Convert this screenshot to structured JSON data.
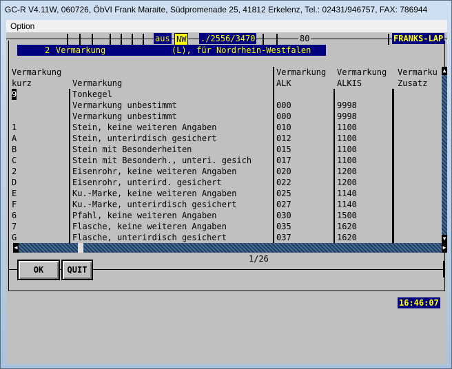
{
  "window": {
    "title": "GC-R V4.11W,   060726, ÖbVI Frank Maraite, Südpromenade 25, 41812 Erkelenz, Tel.: 02431/946757, FAX: 786944"
  },
  "menu": {
    "items": [
      "Option"
    ]
  },
  "toolbar": {
    "source_label": "aus",
    "region": "NW",
    "record_path": "./2556/3470",
    "value": "80",
    "host": "FRANKS-LAP"
  },
  "heading": {
    "number": "2",
    "name": "Vermarkung",
    "subtitle": "(L), für Nordrhein-Westfalen"
  },
  "table": {
    "headers": {
      "c1a": "Vermarkung",
      "c1b": "kurz",
      "c2": "Vermarkung",
      "c3a": "Vermarkung",
      "c3b": "ALK",
      "c4a": "Vermarkung",
      "c4b": "ALKIS",
      "c5a": "Vermarku",
      "c5b": "Zusatz"
    },
    "rows": [
      [
        "9",
        "Tonkegel",
        "",
        ""
      ],
      [
        "",
        "Vermarkung unbestimmt",
        "000",
        "9998"
      ],
      [
        "",
        "Vermarkung unbestimmt",
        "000",
        "9998"
      ],
      [
        "1",
        "Stein, keine weiteren Angaben",
        "010",
        "1100"
      ],
      [
        "A",
        "Stein, unterirdisch gesichert",
        "012",
        "1100"
      ],
      [
        "B",
        "Stein mit Besonderheiten",
        "015",
        "1100"
      ],
      [
        "C",
        "Stein mit Besonderh., unteri. gesich",
        "017",
        "1100"
      ],
      [
        "2",
        "Eisenrohr, keine weiteren Angaben",
        "020",
        "1200"
      ],
      [
        "D",
        "Eisenrohr, unterird. gesichert",
        "022",
        "1200"
      ],
      [
        "E",
        "Ku.-Marke, keine weiteren Angaben",
        "025",
        "1140"
      ],
      [
        "F",
        "Ku.-Marke, unterirdisch gesichert",
        "027",
        "1140"
      ],
      [
        "6",
        "Pfahl, keine weiteren Angaben",
        "030",
        "1500"
      ],
      [
        "7",
        "Flasche, keine weiteren Angaben",
        "035",
        "1620"
      ],
      [
        "G",
        "Flasche, unterirdisch gesichert",
        "037",
        "1620"
      ]
    ]
  },
  "pager": {
    "text": "1/26"
  },
  "buttons": {
    "ok": "OK",
    "quit": "QUIT"
  },
  "clock": {
    "time": "16:46:07"
  },
  "colors": {
    "accent_blue": "#000080",
    "text_yellow": "#ffff00",
    "panel_gray": "#c0c0c0"
  }
}
